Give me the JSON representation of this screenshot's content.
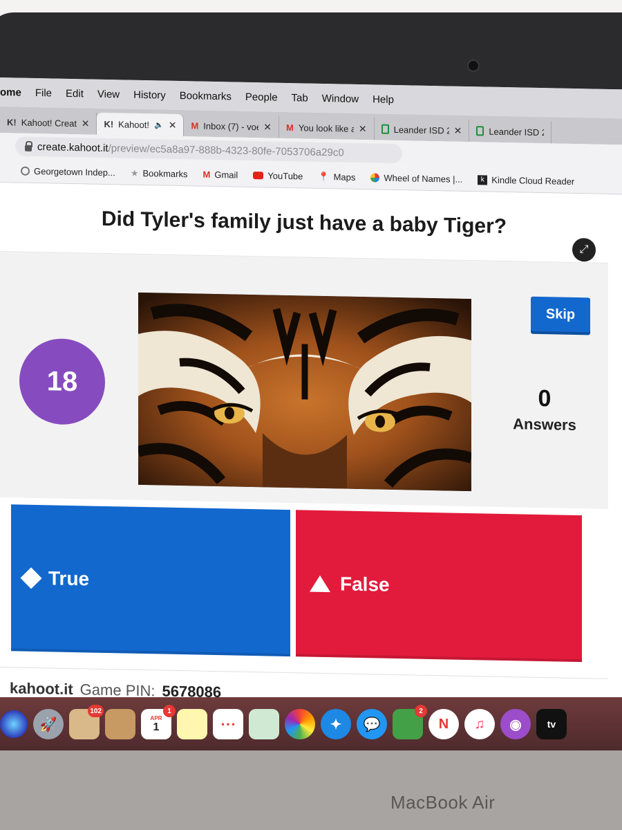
{
  "menubar": {
    "app": "ome",
    "items": [
      "File",
      "Edit",
      "View",
      "History",
      "Bookmarks",
      "People",
      "Tab",
      "Window",
      "Help"
    ]
  },
  "tabs": [
    {
      "icon": "K!",
      "title": "Kahoot! Create",
      "active": false
    },
    {
      "icon": "K!",
      "title": "Kahoot!",
      "active": true
    },
    {
      "icon": "M",
      "title": "Inbox (7) - voe",
      "active": false
    },
    {
      "icon": "M",
      "title": "You look like a",
      "active": false
    },
    {
      "icon": "doc",
      "title": "Leander ISD 2",
      "active": false
    },
    {
      "icon": "doc",
      "title": "Leander ISD 2",
      "active": false
    }
  ],
  "address": {
    "host": "create.kahoot.it",
    "path": "/preview/ec5a8a97-888b-4323-80fe-7053706a29c0"
  },
  "bookmarks": [
    "Georgetown Indep...",
    "Bookmarks",
    "Gmail",
    "YouTube",
    "Maps",
    "Wheel of Names |...",
    "Kindle Cloud Reader"
  ],
  "question": "Did Tyler's family just have a baby Tiger?",
  "timer": "18",
  "skip_label": "Skip",
  "answers_count": "0",
  "answers_label": "Answers",
  "options": {
    "true_label": "True",
    "false_label": "False"
  },
  "footer": {
    "site": "kahoot.it",
    "pin_label": "Game PIN:",
    "pin": "5678086"
  },
  "dock": {
    "mail_badge": "102",
    "calendar_month": "APR",
    "calendar_day": "1",
    "calendar_badge": "1",
    "facetime_badge": "2",
    "tv_label": "tv"
  },
  "laptop_brand": "MacBook Air",
  "colors": {
    "kahoot_blue": "#1368ce",
    "kahoot_red": "#e21b3c",
    "kahoot_purple": "#864cbf"
  }
}
